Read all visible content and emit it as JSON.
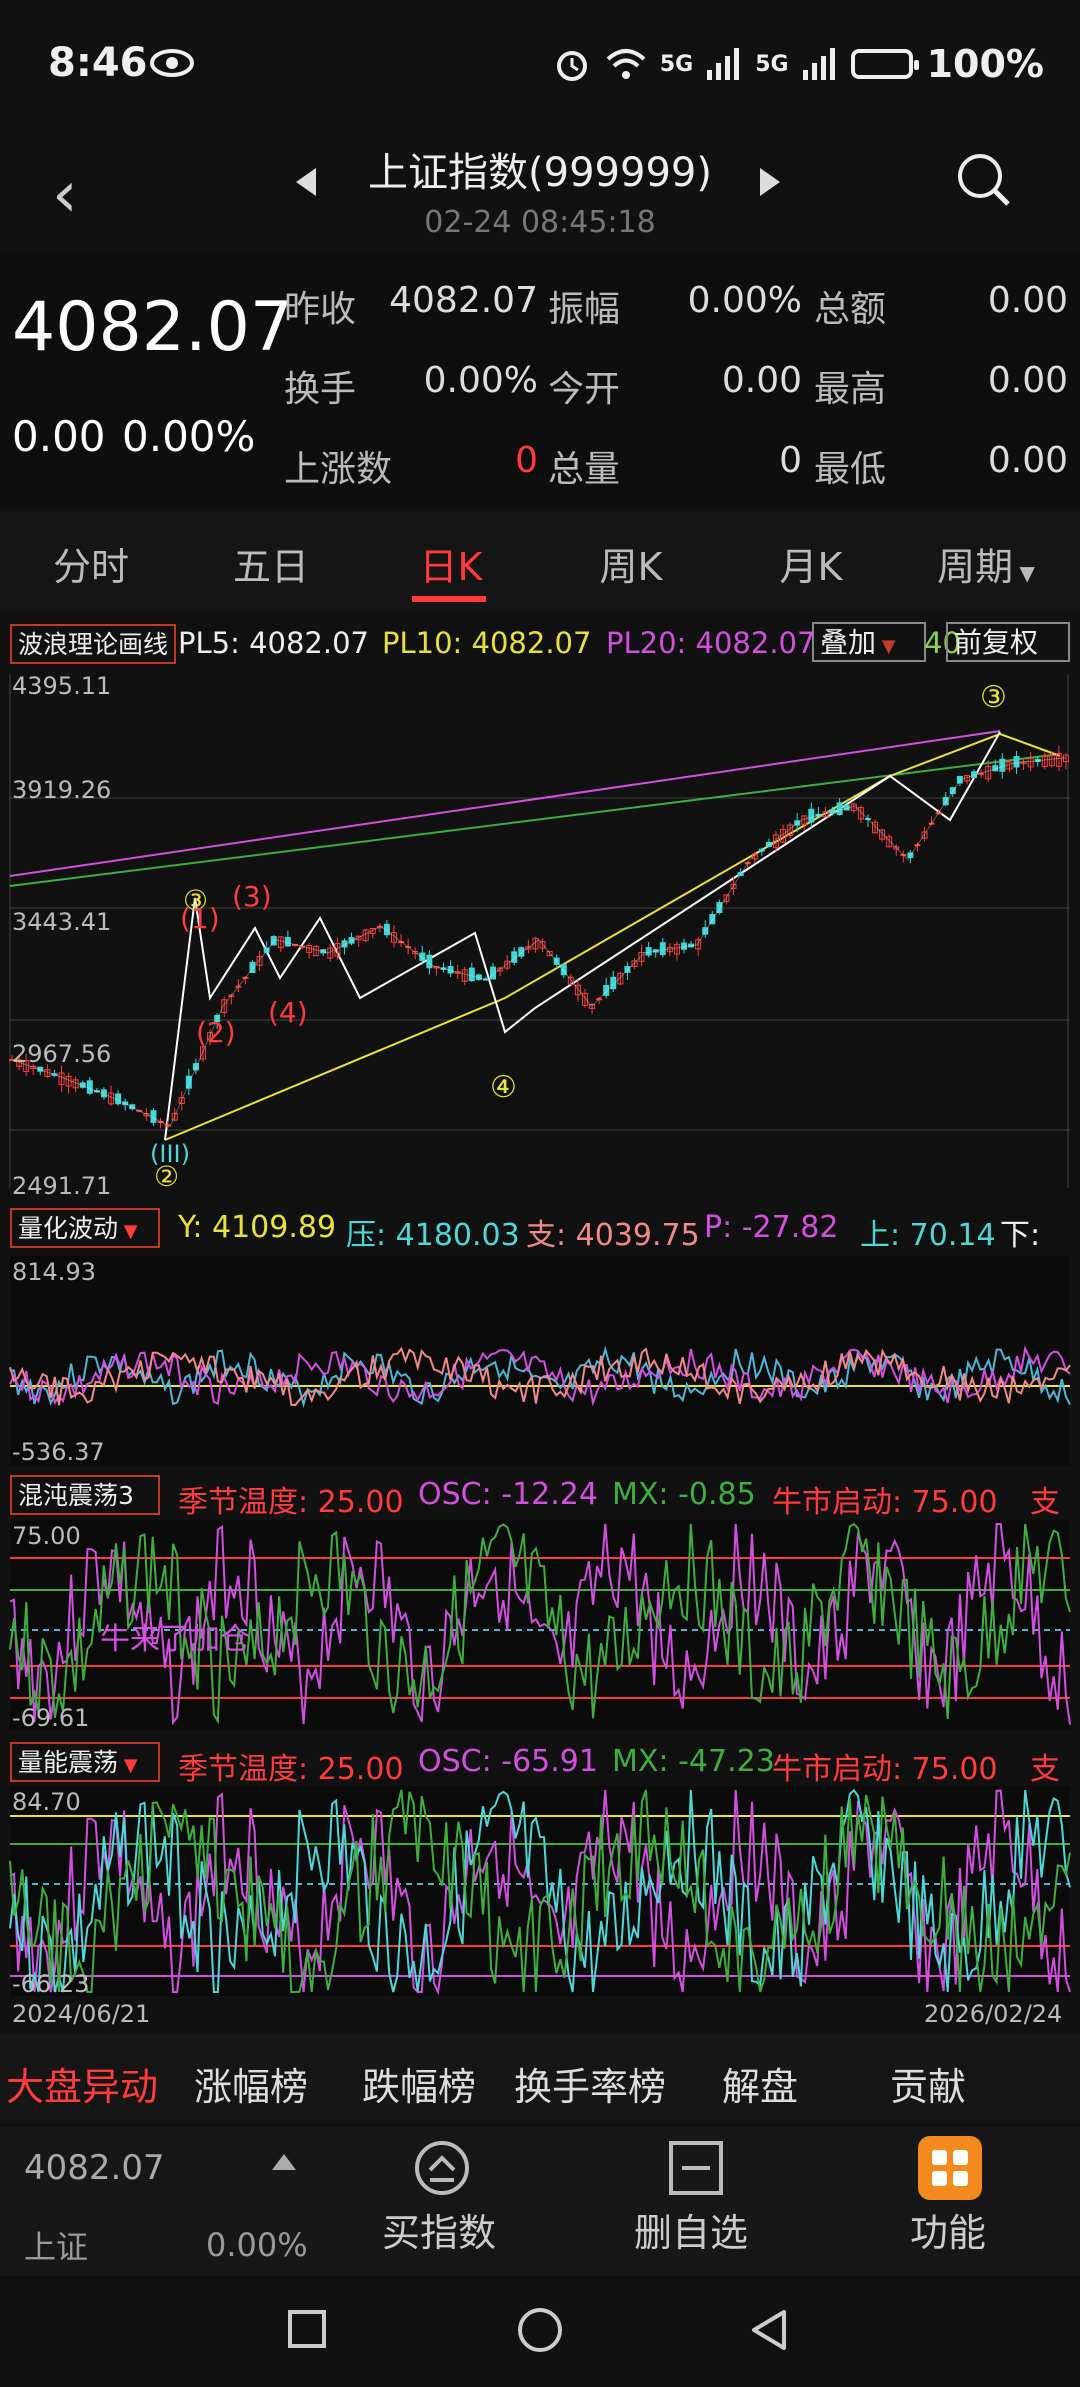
{
  "status": {
    "time": "8:46",
    "battery": "100%",
    "net1": "5G",
    "net2": "5G"
  },
  "header": {
    "title": "上证指数(999999)",
    "subtitle": "02-24 08:45:18"
  },
  "quote": {
    "price": "4082.07",
    "change": "0.00",
    "change_pct": "0.00%",
    "rows": [
      [
        {
          "l": "昨收",
          "v": "4082.07"
        },
        {
          "l": "振幅",
          "v": "0.00%"
        },
        {
          "l": "总额",
          "v": "0.00"
        }
      ],
      [
        {
          "l": "换手",
          "v": "0.00%"
        },
        {
          "l": "今开",
          "v": "0.00"
        },
        {
          "l": "最高",
          "v": "0.00"
        }
      ],
      [
        {
          "l": "上涨数",
          "v": "0"
        },
        {
          "l": "总量",
          "v": "0"
        },
        {
          "l": "最低",
          "v": "0.00"
        }
      ]
    ]
  },
  "tabs": [
    "分时",
    "五日",
    "日K",
    "周K",
    "月K",
    "周期"
  ],
  "main_chart": {
    "indicator": "波浪理论画线",
    "pl5": "PL5: 4082.07",
    "pl10": "PL10: 4082.07",
    "pl20": "PL20: 4082.07",
    "pl20_tail": "40",
    "overlay_btn": "叠加",
    "adjust_btn": "前复权",
    "y_labels": [
      "4395.11",
      "3919.26",
      "3443.41",
      "2967.56",
      "2491.71"
    ],
    "wave_labels": {
      "w1": "(1)",
      "w2": "(2)",
      "w3": "(3)",
      "w4": "(4)",
      "c3": "③",
      "c2": "②",
      "c4": "④",
      "c3b": "③",
      "c3lo": "(III)"
    }
  },
  "chart_data": {
    "type": "line",
    "title": "",
    "x_range": [
      "2024/06/21",
      "2026/02/24"
    ],
    "ylim": [
      2491.71,
      4395.11
    ],
    "series": [
      {
        "name": "PL5",
        "values": [
          2950,
          2880,
          2800,
          2700,
          3150,
          3400,
          3350,
          3450,
          3300,
          3250,
          3400,
          3150,
          3350,
          3380,
          3700,
          3850,
          3900,
          3700,
          4000,
          4060,
          4082
        ]
      }
    ]
  },
  "ind1": {
    "name": "量化波动",
    "y": "Y: 4109.89",
    "ya": "压: 4180.03",
    "yb": "支: 4039.75",
    "p": "P: -27.82",
    "up": "上: 70.14",
    "down": "下:",
    "top": "814.93",
    "bottom": "-536.37"
  },
  "ind2": {
    "name": "混沌震荡3",
    "a": "季节温度: 25.00",
    "b": "OSC: -12.24",
    "c": "MX: -0.85",
    "d": "牛市启动: 75.00",
    "e": "支",
    "top": "75.00",
    "bottom": "-69.61",
    "note": "牛来了加仓"
  },
  "ind3": {
    "name": "量能震荡",
    "a": "季节温度: 25.00",
    "b": "OSC: -65.91",
    "c": "MX: -47.23",
    "d": "牛市启动: 75.00",
    "e": "支",
    "top": "84.70",
    "bottom": "-66.23",
    "date_left": "2024/06/21",
    "date_right": "2026/02/24"
  },
  "bottom_tabs": [
    "大盘异动",
    "涨幅榜",
    "跌幅榜",
    "换手率榜",
    "解盘",
    "贡献"
  ],
  "footer": {
    "price": "4082.07",
    "name": "上证",
    "pct": "0.00%",
    "btn1": "买指数",
    "btn2": "删自选",
    "btn3": "功能"
  }
}
